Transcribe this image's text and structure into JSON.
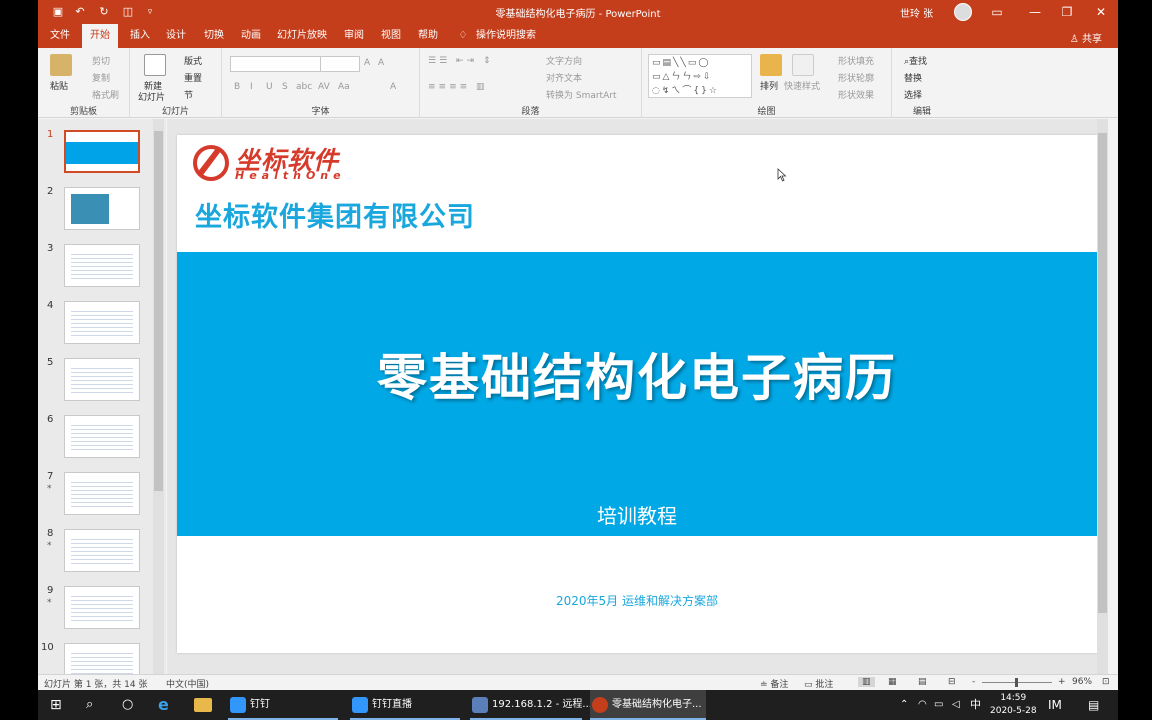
{
  "window": {
    "title": "零基础结构化电子病历  -  PowerPoint",
    "user": "世玲 张",
    "share": "共享",
    "controls": [
      "▭",
      "—",
      "❐",
      "✕"
    ]
  },
  "tabs": [
    "文件",
    "开始",
    "插入",
    "设计",
    "切换",
    "动画",
    "幻灯片放映",
    "审阅",
    "视图",
    "帮助",
    "操作说明搜索"
  ],
  "ribbon": {
    "clipboard": {
      "paste": "粘贴",
      "cut": "剪切",
      "copy": "复制",
      "format_painter": "格式刷",
      "label": "剪贴板"
    },
    "slides": {
      "new_slide": "新建",
      "new_slide2": "幻灯片",
      "layout": "版式",
      "reset": "重置",
      "section": "节",
      "label": "幻灯片"
    },
    "font": {
      "label": "字体",
      "buttons": [
        "B",
        "I",
        "U",
        "S",
        "abc",
        "AV",
        "Aa",
        "A"
      ],
      "grow": "A",
      "shrink": "A"
    },
    "paragraph": {
      "label": "段落",
      "text_direction": "文字方向",
      "align_text": "对齐文本",
      "smartart": "转换为 SmartArt"
    },
    "drawing": {
      "label": "绘图",
      "arrange": "排列",
      "quick_styles": "快速样式",
      "shape_fill": "形状填充",
      "shape_outline": "形状轮廓",
      "shape_effects": "形状效果",
      "shapes_row1": "▭▤╲╲▭◯",
      "shapes_row2": "▭△ㄣㄣ⇨⇩",
      "shapes_row3": "◌↯ㄟ⌒{}☆"
    },
    "editing": {
      "label": "编辑",
      "find": "查找",
      "replace": "替换",
      "select": "选择"
    }
  },
  "thumbnails": {
    "numbers": [
      "1",
      "2",
      "3",
      "4",
      "5",
      "6",
      "7",
      "8",
      "9",
      "10"
    ],
    "star": "*",
    "active_title": "零基础结构化电子病历"
  },
  "slide": {
    "logo_cn": "坐标软件",
    "logo_en": "HealthOne",
    "company": "坐标软件集团有限公司",
    "title": "零基础结构化电子病历",
    "subtitle": "培训教程",
    "dept": "2020年5月  运维和解决方案部"
  },
  "statusbar": {
    "slide_info": "幻灯片 第 1 张，共 14 张",
    "language": "中文(中国)",
    "notes": "备注",
    "comments": "批注",
    "zoom": "96%",
    "minus": "-",
    "plus": "+"
  },
  "taskbar": {
    "apps": [
      "钉钉",
      "钉钉直播",
      "192.168.1.2 - 远程...",
      "零基础结构化电子..."
    ],
    "tray_lang": "中",
    "time": "14:59",
    "date": "2020-5-28"
  },
  "colors": {
    "accent": "#c43e1c",
    "slide_blue": "#00a8e6",
    "logo_red": "#d63a2b"
  }
}
